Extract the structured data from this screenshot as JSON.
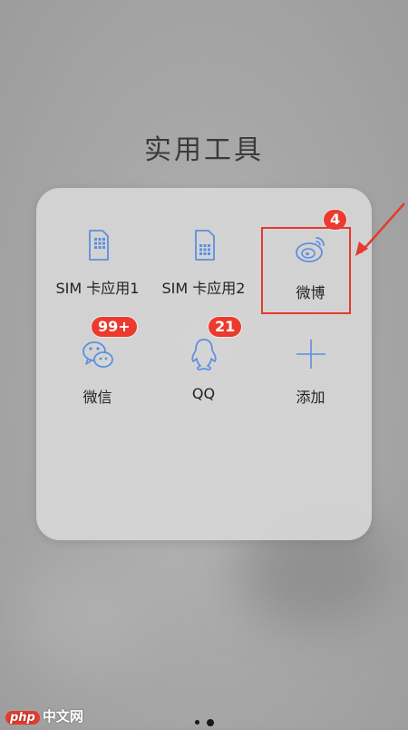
{
  "folder": {
    "title": "实用工具",
    "apps": [
      {
        "label": "SIM 卡应用1",
        "icon": "sim-card-icon"
      },
      {
        "label": "SIM 卡应用2",
        "icon": "sim-card-icon"
      },
      {
        "label": "微博",
        "icon": "weibo-icon",
        "badge": "4"
      },
      {
        "label": "微信",
        "icon": "wechat-icon",
        "badge": "99+"
      },
      {
        "label": "QQ",
        "icon": "qq-penguin-icon",
        "badge": "21"
      },
      {
        "label": "添加",
        "icon": "plus-icon"
      }
    ],
    "pages": 2,
    "current_page": 2
  },
  "colors": {
    "icon_blue": "#5b8fe0",
    "badge_red": "#ec3b2e",
    "annotation_red": "#e53a2d"
  },
  "watermark": {
    "brand": "php",
    "text": "中文网"
  }
}
